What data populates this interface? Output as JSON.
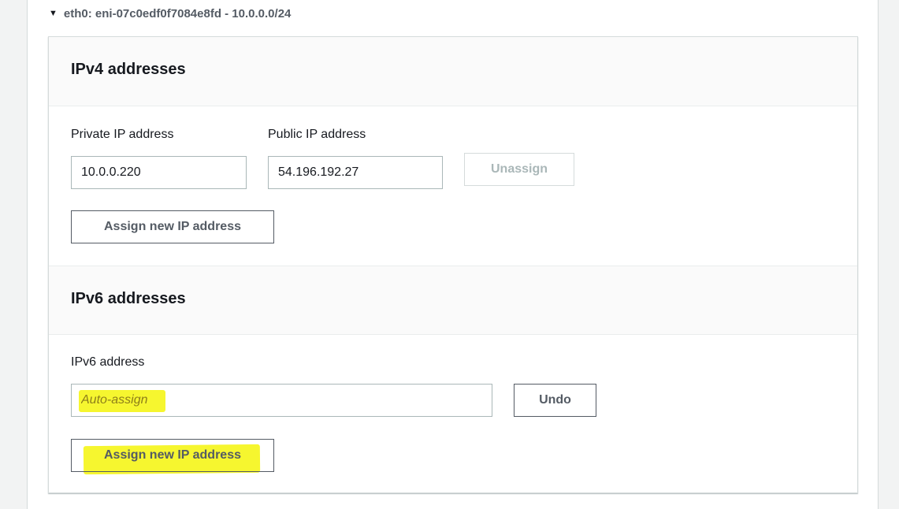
{
  "eni": {
    "caret": "▼",
    "title": "eth0: eni-07c0edf0f7084e8fd - 10.0.0.0/24"
  },
  "ipv4": {
    "heading": "IPv4 addresses",
    "private_label": "Private IP address",
    "public_label": "Public IP address",
    "private_value": "10.0.0.220",
    "public_value": "54.196.192.27",
    "unassign_label": "Unassign",
    "assign_label": "Assign new IP address"
  },
  "ipv6": {
    "heading": "IPv6 addresses",
    "address_label": "IPv6 address",
    "address_placeholder": "Auto-assign",
    "undo_label": "Undo",
    "assign_label": "Assign new IP address"
  },
  "colors": {
    "highlight": "#f5f50a",
    "button_text": "#545b64",
    "disabled_text": "#aab7b8"
  }
}
